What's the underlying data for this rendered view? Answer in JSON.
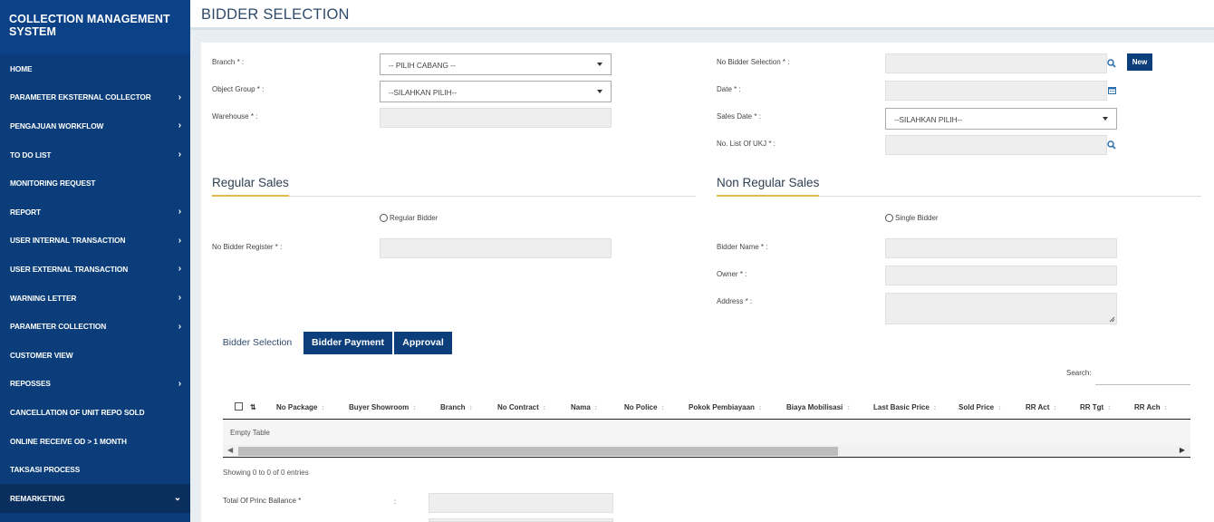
{
  "app": {
    "title": "COLLECTION MANAGEMENT SYSTEM",
    "title_line1": "COLLECTION MANAGEMENT",
    "title_line2": "SYSTEM"
  },
  "sidebar": {
    "items": [
      {
        "label": "HOME",
        "chevron": ""
      },
      {
        "label": "PARAMETER EKSTERNAL COLLECTOR",
        "chevron": "›"
      },
      {
        "label": "PENGAJUAN WORKFLOW",
        "chevron": "›"
      },
      {
        "label": "TO DO LIST",
        "chevron": "›"
      },
      {
        "label": "MONITORING REQUEST",
        "chevron": ""
      },
      {
        "label": "REPORT",
        "chevron": "›"
      },
      {
        "label": "USER INTERNAL TRANSACTION",
        "chevron": "›"
      },
      {
        "label": "USER EXTERNAL TRANSACTION",
        "chevron": "›"
      },
      {
        "label": "WARNING LETTER",
        "chevron": "›"
      },
      {
        "label": "PARAMETER COLLECTION",
        "chevron": "›"
      },
      {
        "label": "CUSTOMER VIEW",
        "chevron": ""
      },
      {
        "label": "REPOSSES",
        "chevron": "›"
      },
      {
        "label": "CANCELLATION OF UNIT REPO SOLD",
        "chevron": ""
      },
      {
        "label": "ONLINE RECEIVE OD > 1 MONTH",
        "chevron": ""
      },
      {
        "label": "TAKSASI PROCESS",
        "chevron": ""
      },
      {
        "label": "REMARKETING",
        "chevron": "⌄"
      }
    ]
  },
  "header": {
    "title": "BIDDER SELECTION"
  },
  "form": {
    "branch_label": "Branch * :",
    "branch_value": "-- PILIH CABANG --",
    "object_group_label": "Object Group * :",
    "object_group_value": "--SILAHKAN PILIH--",
    "warehouse_label": "Warehouse * :",
    "no_bidder_selection_label": "No Bidder Selection * :",
    "date_label": "Date * :",
    "sales_date_label": "Sales Date * :",
    "sales_date_value": "--SILAHKAN PILIH--",
    "no_list_ukj_label": "No. List Of UKJ * :",
    "new_button": "New"
  },
  "regular": {
    "title": "Regular Sales",
    "radio_label": "Regular Bidder",
    "no_bidder_register_label": "No Bidder Register * :"
  },
  "non_regular": {
    "title": "Non Regular Sales",
    "radio_label": "Single Bidder",
    "bidder_name_label": "Bidder Name * :",
    "owner_label": "Owner * :",
    "address_label": "Address * :"
  },
  "tabs": [
    {
      "label": "Bidder Selection"
    },
    {
      "label": "Bidder Payment"
    },
    {
      "label": "Approval"
    }
  ],
  "table": {
    "search_label": "Search:",
    "columns": [
      "No Package",
      "Buyer Showroom",
      "Branch",
      "No Contract",
      "Nama",
      "No Police",
      "Pokok Pembiayaan",
      "Biaya Mobilisasi",
      "Last Basic Price",
      "Sold Price",
      "RR Act",
      "RR Tgt",
      "RR Ach"
    ],
    "empty_text": "Empty Table",
    "showing_text": "Showing 0 to 0 of 0 entries"
  },
  "totals": {
    "princ_label": "Total Of Princ Ballance *",
    "colon": ":"
  },
  "colors": {
    "sidebar": "#0a3d7a",
    "accent_button": "#0b3e7b",
    "section_accent": "#e6b94e"
  },
  "icons": [
    "search-icon",
    "calendar-icon",
    "caret-down-icon",
    "sort-icon",
    "chevron-right-icon"
  ]
}
